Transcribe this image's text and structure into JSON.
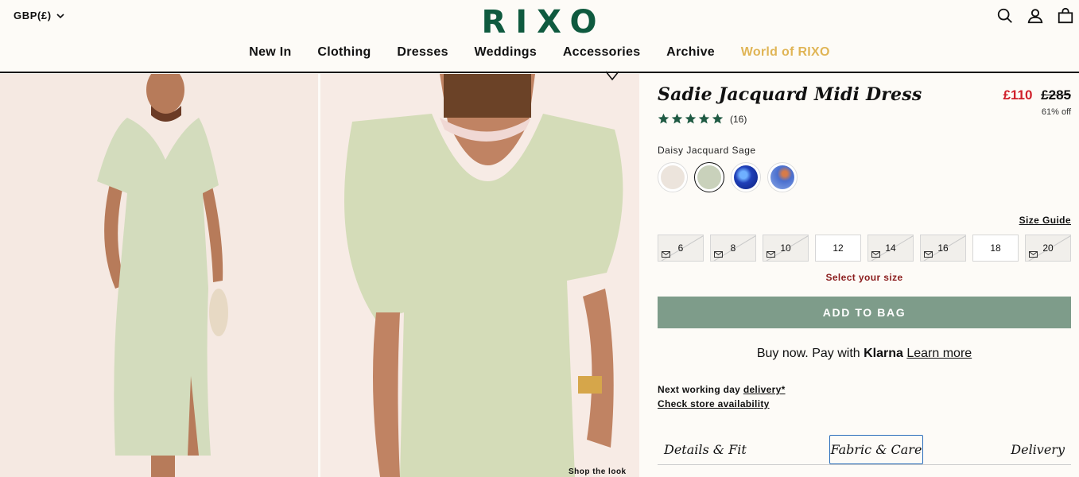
{
  "header": {
    "currency": "GBP(£)",
    "logo": "RIXO",
    "nav": [
      "New In",
      "Clothing",
      "Dresses",
      "Weddings",
      "Accessories",
      "Archive",
      "World of RIXO"
    ]
  },
  "gallery": {
    "shop_the_look": "Shop the look"
  },
  "product": {
    "title": "Sadie Jacquard Midi Dress",
    "price_now": "£110",
    "price_was": "£285",
    "discount": "61% off",
    "rating_count": "(16)",
    "rating_stars": 5,
    "colour_name": "Daisy Jacquard Sage",
    "swatches": [
      {
        "name": "cream",
        "color": "#ece4dc"
      },
      {
        "name": "sage",
        "color": "#c9d1bb"
      },
      {
        "name": "blue-print",
        "color": "#1f3fb8"
      },
      {
        "name": "blue-floral",
        "color": "#4a6fcf"
      }
    ],
    "size_guide": "Size Guide",
    "sizes": [
      {
        "label": "6",
        "available": false
      },
      {
        "label": "8",
        "available": false
      },
      {
        "label": "10",
        "available": false
      },
      {
        "label": "12",
        "available": true
      },
      {
        "label": "14",
        "available": false
      },
      {
        "label": "16",
        "available": false
      },
      {
        "label": "18",
        "available": true
      },
      {
        "label": "20",
        "available": false
      }
    ],
    "select_size": "Select your size",
    "add_to_bag": "ADD TO BAG",
    "klarna": {
      "prefix": "Buy now. Pay with",
      "brand": "Klarna",
      "learn_more": "Learn more"
    },
    "delivery": {
      "prefix": "Next working day",
      "link": "delivery*"
    },
    "store": "Check store availability",
    "tabs": [
      "Details & Fit",
      "Fabric & Care",
      "Delivery"
    ]
  },
  "colors": {
    "accent_sale": "#d0202b",
    "bag_button": "#7e9c8a",
    "world_link": "#e0b556",
    "star": "#1f5a43"
  }
}
